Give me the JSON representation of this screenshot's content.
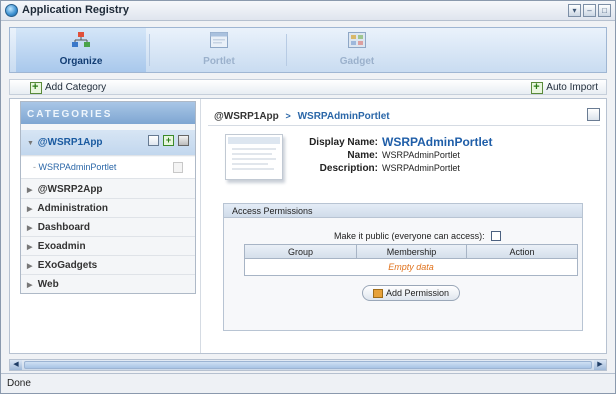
{
  "window": {
    "title": "Application Registry"
  },
  "window_controls": [
    "▾",
    "–",
    "□"
  ],
  "tabs": [
    {
      "label": "Organize",
      "active": true
    },
    {
      "label": "Portlet",
      "active": false
    },
    {
      "label": "Gadget",
      "active": false
    }
  ],
  "toolbar": {
    "add_category": "Add Category",
    "auto_import": "Auto Import"
  },
  "categories": {
    "header": "CATEGORIES",
    "selected": {
      "label": "@WSRP1App",
      "child": "WSRPAdminPortlet"
    },
    "items": [
      "@WSRP2App",
      "Administration",
      "Dashboard",
      "Exoadmin",
      "EXoGadgets",
      "Web"
    ]
  },
  "breadcrumb": {
    "root": "@WSRP1App",
    "separator": ">",
    "current": "WSRPAdminPortlet"
  },
  "portlet": {
    "display_name_label": "Display Name:",
    "display_name": "WSRPAdminPortlet",
    "name_label": "Name:",
    "name": "WSRPAdminPortlet",
    "description_label": "Description:",
    "description": "WSRPAdminPortlet"
  },
  "permissions": {
    "title": "Access Permissions",
    "public_label": "Make it public (everyone can access):",
    "public_checked": false,
    "columns": [
      "Group",
      "Membership",
      "Action"
    ],
    "empty_text": "Empty data",
    "add_button": "Add Permission"
  },
  "scrollbar": {
    "left": "◀",
    "right": "▶"
  },
  "status": {
    "text": "Done"
  }
}
